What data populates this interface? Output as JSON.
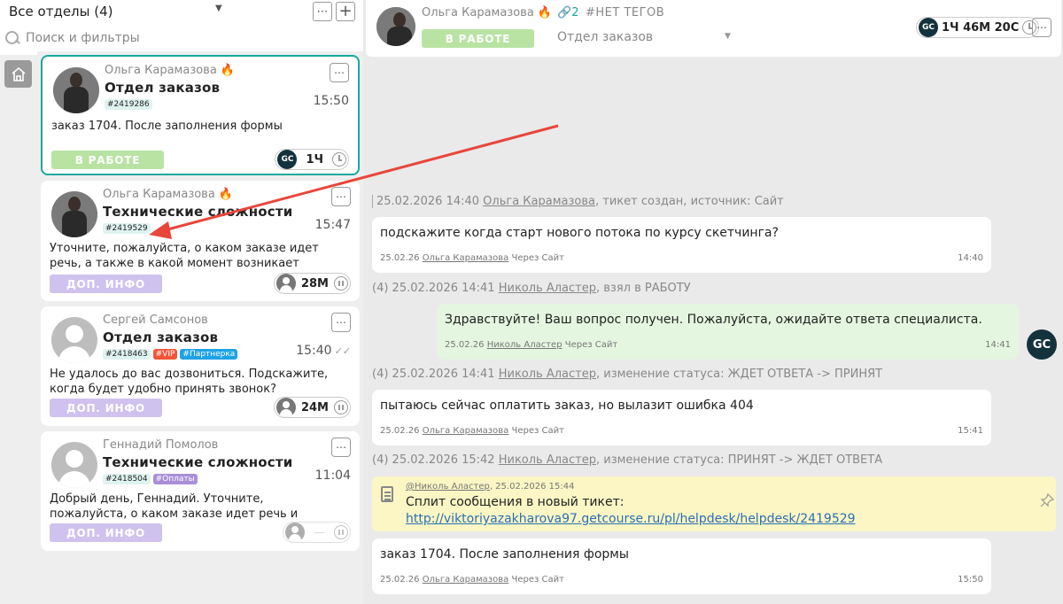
{
  "sidebar": {
    "dept_title": "Все отделы (4)",
    "menu_icon": "⋯",
    "add_icon": "+",
    "search_placeholder": "Поиск и фильтры"
  },
  "tickets": [
    {
      "author": "Ольга Карамазова",
      "hot": true,
      "subject": "Отдел заказов",
      "tags": [
        "#2419286"
      ],
      "time": "15:50",
      "message": "заказ 1704. После заполнения формы",
      "status": "В РАБОТЕ",
      "timer": "1Ч",
      "timer_avatar": "GC",
      "timer_icon": "clock-icon"
    },
    {
      "author": "Ольга Карамазова",
      "hot": true,
      "subject": "Технические сложности",
      "tags": [
        "#2419529"
      ],
      "time": "15:47",
      "message": "Уточните, пожалуйста, о каком заказе идет речь, а также в какой момент возникает ошибка? После...",
      "status": "ДОП. ИНФО",
      "timer": "28М",
      "timer_avatar": "user",
      "timer_icon": "pause-icon"
    },
    {
      "author": "Сергей Самсонов",
      "hot": false,
      "subject": "Отдел заказов",
      "tags": [
        "#2418463",
        "#VIP",
        "#Партнерка"
      ],
      "time": "15:40",
      "message": "Не удалось до вас дозвониться. Подскажите, когда будет удобно принять звонок?",
      "status": "ДОП. ИНФО",
      "timer": "24М",
      "timer_avatar": "user",
      "timer_icon": "pause-icon"
    },
    {
      "author": "Геннадий Помолов",
      "hot": false,
      "subject": "Технические сложности",
      "tags": [
        "#2418504",
        "#Оплаты"
      ],
      "time": "11:04",
      "message": "Добрый день, Геннадий. Уточните, пожалуйста, о каком заказе идет речь и пришлите поясняющий...",
      "status": "ДОП. ИНФО",
      "timer": "—",
      "timer_avatar": "user",
      "timer_icon": "pause-icon"
    }
  ],
  "header": {
    "author": "Ольга Карамазова",
    "links": "2",
    "no_tags": "#НЕТ ТЕГОВ",
    "status": "В РАБОТЕ",
    "department": "Отдел заказов",
    "timer": "1Ч 46М 20С",
    "timer_avatar": "GC"
  },
  "chat": {
    "sys1": {
      "date": "25.02.2026 14:40",
      "user": "Ольга Карамазова",
      "text": ", тикет создан, источник: Сайт"
    },
    "msg1": {
      "text": "подскажите когда старт нового потока по курсу скетчинга?",
      "date": "25.02.26",
      "author": "Ольга Карамазова",
      "via": "Через Сайт",
      "time": "14:40"
    },
    "sys2": {
      "prefix": "(4) 25.02.2026 14:41",
      "user": "Николь Аластер",
      "text": ", взял в РАБОТУ"
    },
    "msg2": {
      "text": "Здравствуйте! Ваш вопрос получен. Пожалуйста, ожидайте ответа специалиста.",
      "date": "25.02.26",
      "author": "Николь Аластер",
      "via": "Через Сайт",
      "time": "14:41",
      "avatar": "GC"
    },
    "sys3": {
      "prefix": "(4) 25.02.2026 14:41",
      "user": "Николь Аластер",
      "text": ", изменение статуса: ЖДЕТ ОТВЕТА -> ПРИНЯТ"
    },
    "msg3": {
      "text": "пытаюсь сейчас оплатить заказ, но вылазит ошибка 404",
      "date": "25.02.26",
      "author": "Ольга Карамазова",
      "via": "Через Сайт",
      "time": "15:41"
    },
    "sys4": {
      "prefix": "(4) 25.02.2026 15:42",
      "user": "Николь Аластер",
      "text": ", изменение статуса: ПРИНЯТ -> ЖДЕТ ОТВЕТА"
    },
    "note": {
      "user": "@Николь Аластер",
      "datetime": ", 25.02.2026 15:44",
      "title": "Сплит сообщения в новый тикет:",
      "link": "http://viktoriyazakharova97.getcourse.ru/pl/helpdesk/helpdesk/2419529"
    },
    "msg4": {
      "text": "заказ 1704. После заполнения формы",
      "date": "25.02.26",
      "author": "Ольга Карамазова",
      "via": "Через Сайт",
      "time": "15:50"
    }
  },
  "colors": {
    "accent": "#19a89e",
    "in_work": "#b9e3a3",
    "extra_info": "#cfc2ee",
    "arrow": "#e8463a",
    "brand": "#14323d"
  }
}
